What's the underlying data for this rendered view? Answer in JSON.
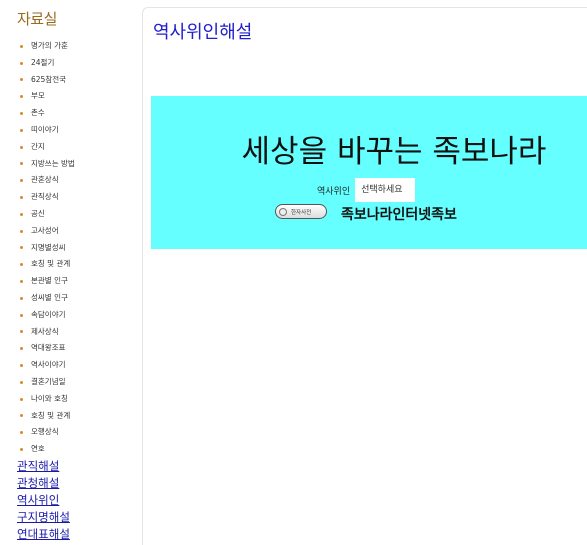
{
  "sidebar": {
    "title": "자료실",
    "items": [
      "명가의 가훈",
      "24절기",
      "625참전국",
      "부모",
      "촌수",
      "띠이야기",
      "간지",
      "지방쓰는 방법",
      "관혼상식",
      "관직상식",
      "공신",
      "고사성어",
      "지명별성씨",
      "호칭 및 관계",
      "본관별 인구",
      "성씨별 인구",
      "속담이야기",
      "제사상식",
      "역대왕조표",
      "역사이야기",
      "결혼기념일",
      "나이와 호칭",
      "호칭 및 관계",
      "오행상식",
      "연호"
    ],
    "links": [
      "관직해설",
      "관청해설",
      "역사위인",
      "구지명해설",
      "연대표해설"
    ],
    "bullet_color": "#d98a2b"
  },
  "main": {
    "title": "역사위인해설",
    "banner": {
      "background": "#66ffff",
      "headline": "세상을 바꾸는 족보나라",
      "select_label": "역사위인",
      "select_value": "선택하세요",
      "dict_button_label": "한자사전",
      "brand": "족보나라인터넷족보"
    }
  }
}
